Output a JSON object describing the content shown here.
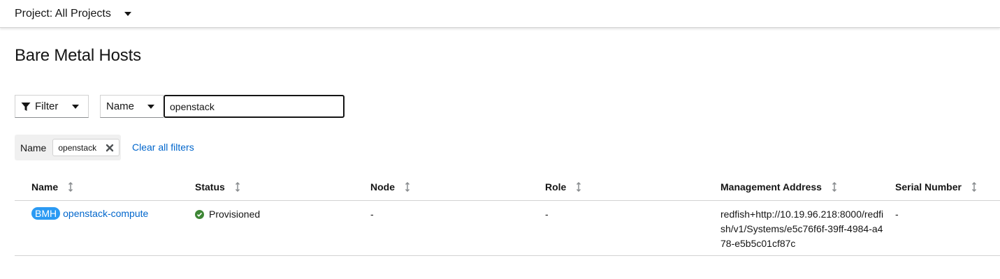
{
  "project": {
    "label": "Project: All Projects"
  },
  "page": {
    "title": "Bare Metal Hosts"
  },
  "toolbar": {
    "filter_label": "Filter",
    "name_dropdown_label": "Name",
    "search_value": "openstack"
  },
  "chips": {
    "category": "Name",
    "value": "openstack",
    "clear_label": "Clear all filters"
  },
  "table": {
    "columns": [
      "Name",
      "Status",
      "Node",
      "Role",
      "Management Address",
      "Serial Number"
    ],
    "rows": [
      {
        "badge": "BMH",
        "name": "openstack-compute",
        "status": "Provisioned",
        "node": "-",
        "role": "-",
        "address": "redfish+http://10.19.96.218:8000/redfish/v1/Systems/e5c76f6f-39ff-4984-a478-e5b5c01cf87c",
        "serial": "-"
      }
    ]
  },
  "colors": {
    "link": "#0066cc",
    "badge": "#2b9af3",
    "success": "#3e8635"
  },
  "icons": [
    "caret-down-icon",
    "filter-icon",
    "close-icon",
    "sort-icon",
    "check-circle-icon"
  ]
}
